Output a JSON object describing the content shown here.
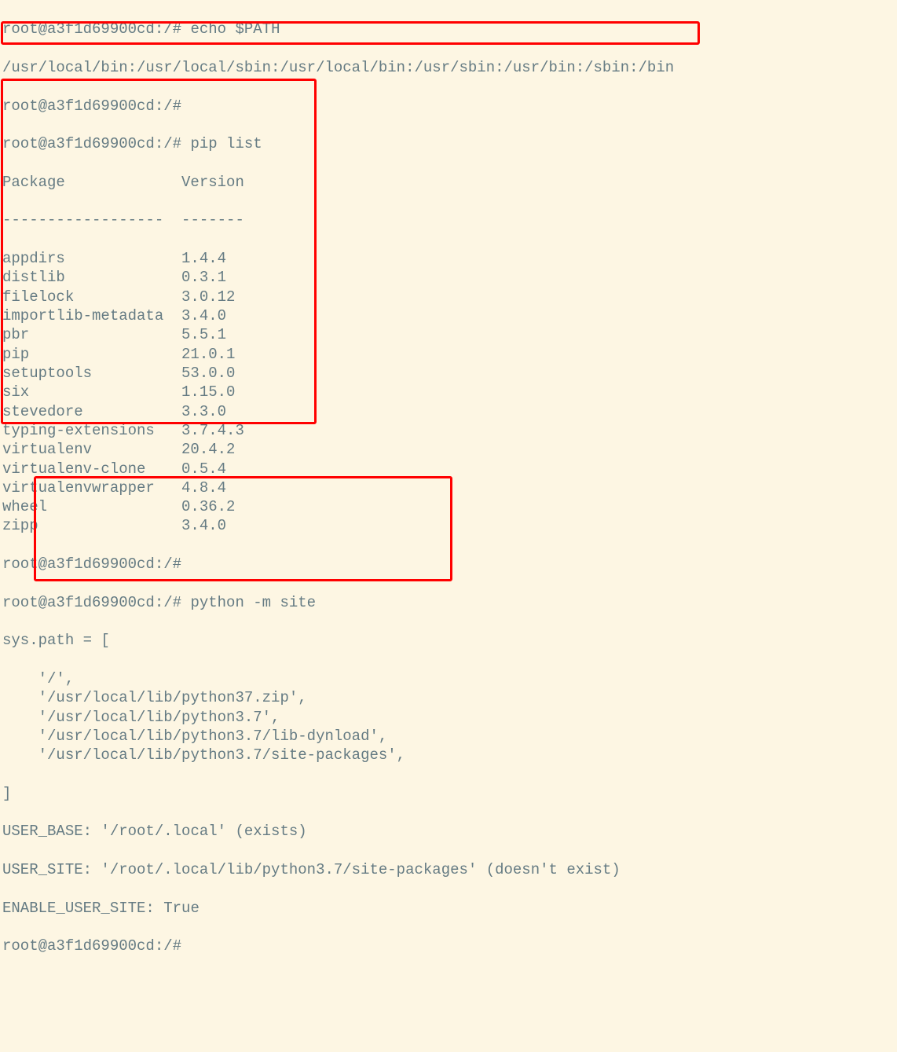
{
  "prompt": "root@a3f1d69900cd:/#",
  "cmd_echo_path": "echo $PATH",
  "path_output": "/usr/local/bin:/usr/local/sbin:/usr/local/bin:/usr/sbin:/usr/bin:/sbin:/bin",
  "cmd_pip_list": "pip list",
  "pip_header_package": "Package",
  "pip_header_version": "Version",
  "pip_divider": "------------------  -------",
  "pip_rows": [
    {
      "pkg": "appdirs",
      "ver": "1.4.4"
    },
    {
      "pkg": "distlib",
      "ver": "0.3.1"
    },
    {
      "pkg": "filelock",
      "ver": "3.0.12"
    },
    {
      "pkg": "importlib-metadata",
      "ver": "3.4.0"
    },
    {
      "pkg": "pbr",
      "ver": "5.5.1"
    },
    {
      "pkg": "pip",
      "ver": "21.0.1"
    },
    {
      "pkg": "setuptools",
      "ver": "53.0.0"
    },
    {
      "pkg": "six",
      "ver": "1.15.0"
    },
    {
      "pkg": "stevedore",
      "ver": "3.3.0"
    },
    {
      "pkg": "typing-extensions",
      "ver": "3.7.4.3"
    },
    {
      "pkg": "virtualenv",
      "ver": "20.4.2"
    },
    {
      "pkg": "virtualenv-clone",
      "ver": "0.5.4"
    },
    {
      "pkg": "virtualenvwrapper",
      "ver": "4.8.4"
    },
    {
      "pkg": "wheel",
      "ver": "0.36.2"
    },
    {
      "pkg": "zipp",
      "ver": "3.4.0"
    }
  ],
  "cmd_python_site": "python -m site",
  "site_header": "sys.path = [",
  "site_paths": [
    "'/',",
    "'/usr/local/lib/python37.zip',",
    "'/usr/local/lib/python3.7',",
    "'/usr/local/lib/python3.7/lib-dynload',",
    "'/usr/local/lib/python3.7/site-packages',"
  ],
  "site_close": "]",
  "user_base": "USER_BASE: '/root/.local' (exists)",
  "user_site": "USER_SITE: '/root/.local/lib/python3.7/site-packages' (doesn't exist)",
  "enable_user_site": "ENABLE_USER_SITE: True"
}
